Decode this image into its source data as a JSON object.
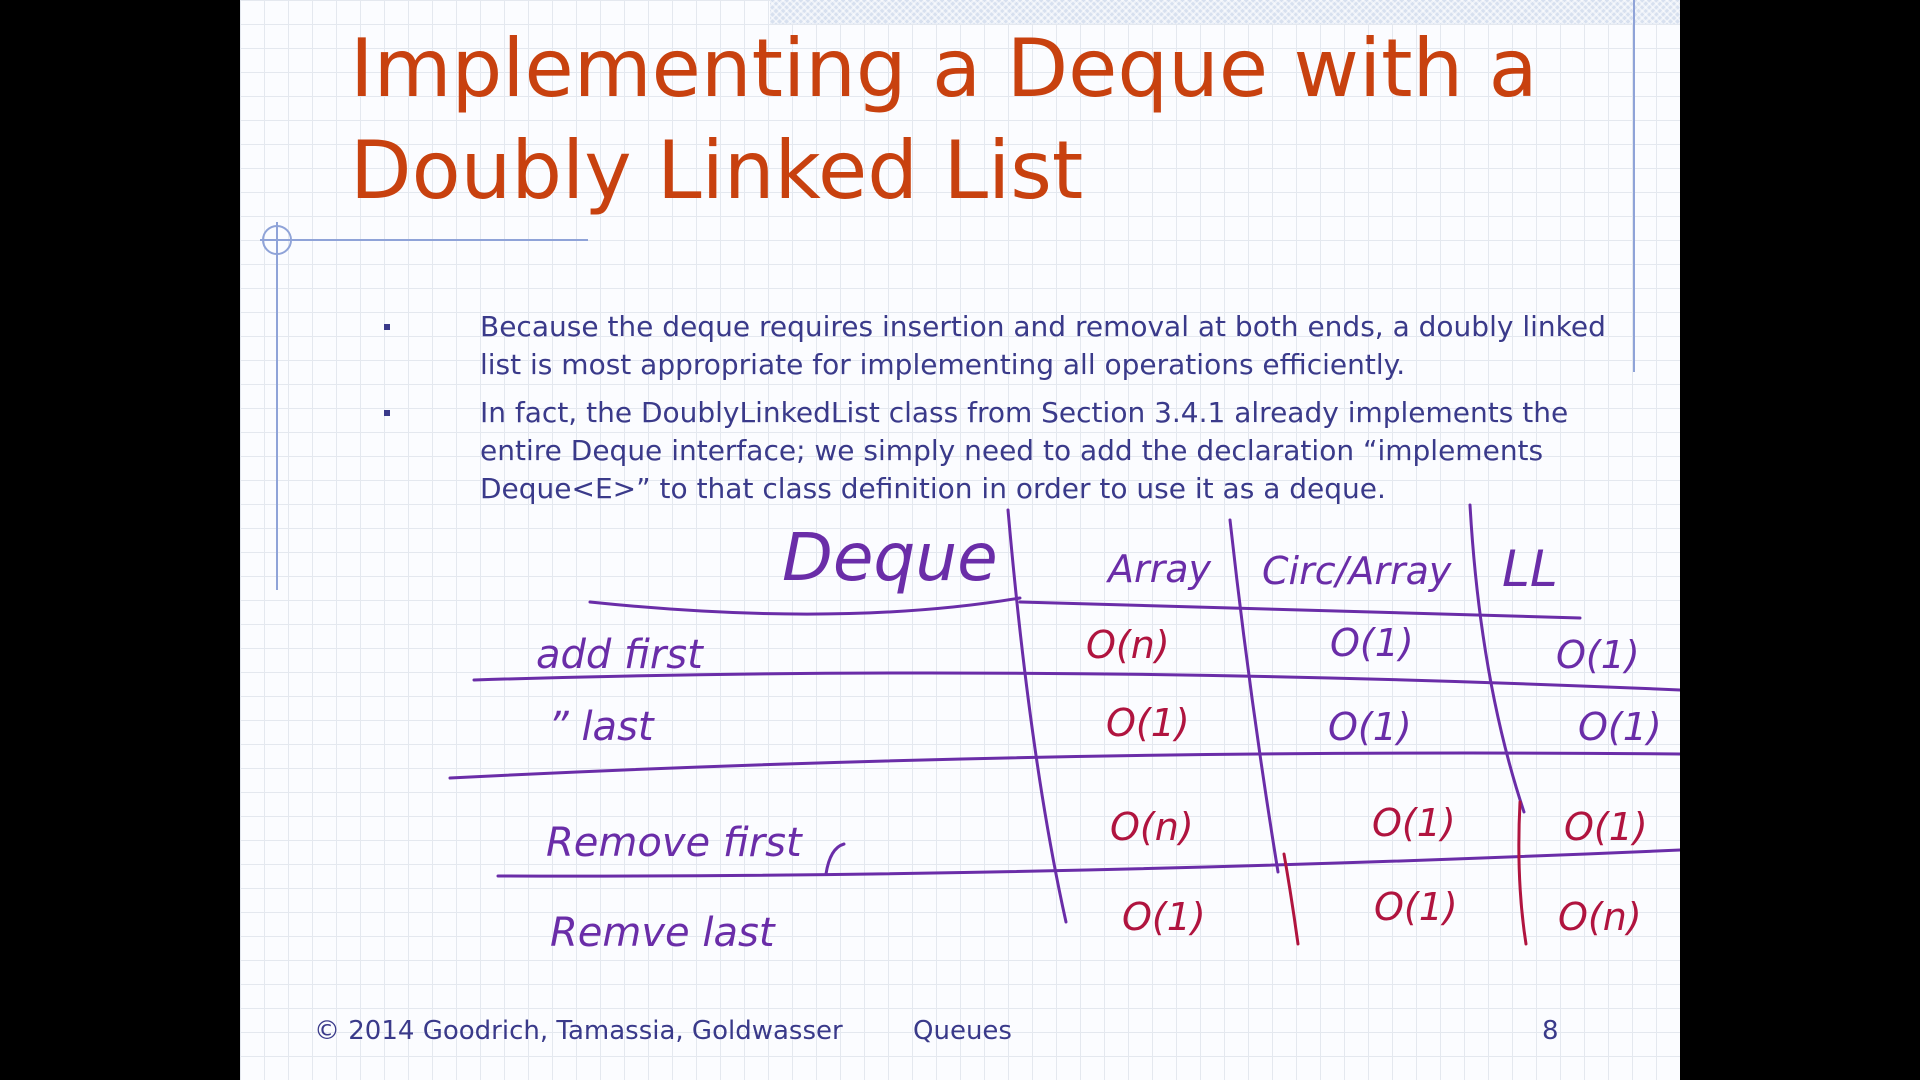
{
  "slide": {
    "title_line1": "Implementing a Deque with a",
    "title_line2": "Doubly Linked List",
    "bullets": [
      "Because the deque requires insertion and removal at both ends, a doubly linked list is most appropriate for implementing all operations efficiently.",
      "In fact, the DoublyLinkedList class from Section 3.4.1 already implements the entire Deque interface; we simply need to add the declaration “implements Deque<E>” to that class definition in order to use it as a deque."
    ],
    "footer": {
      "copyright": "© 2014 Goodrich, Tamassia, Goldwasser",
      "section": "Queues",
      "page": "8"
    }
  },
  "annotation_table": {
    "header": "Deque",
    "columns": [
      "Array",
      "Circ/Array",
      "LL"
    ],
    "rows": [
      {
        "op": "add first",
        "values": [
          "O(n)",
          "O(1)",
          "O(1)"
        ]
      },
      {
        "op": "” last",
        "values": [
          "O(1)",
          "O(1)",
          "O(1)"
        ]
      },
      {
        "op": "Remove first",
        "values": [
          "O(n)",
          "O(1)",
          "O(1)"
        ]
      },
      {
        "op": "Remve last",
        "values": [
          "O(1)",
          "O(1)",
          "O(n)"
        ]
      }
    ]
  },
  "colors": {
    "title": "#c8410f",
    "body_text": "#3a3a8a",
    "ink_purple": "#6a2da8",
    "ink_red": "#b0143f",
    "guide_line": "#8fa3d8"
  }
}
